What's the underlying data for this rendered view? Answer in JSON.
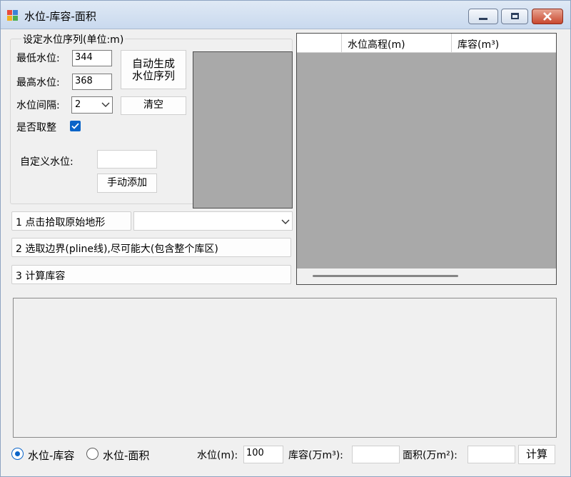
{
  "window": {
    "title": "水位-库容-面积"
  },
  "settings": {
    "group_title": "设定水位序列(单位:m)",
    "min_label": "最低水位:",
    "min_value": "344",
    "max_label": "最高水位:",
    "max_value": "368",
    "interval_label": "水位间隔:",
    "interval_value": "2",
    "round_label": "是否取整",
    "round_checked": true,
    "auto_generate_label": "自动生成\n水位序列",
    "clear_label": "清空",
    "custom_label": "自定义水位:",
    "custom_value": "",
    "manual_add_label": "手动添加"
  },
  "steps": {
    "step1_label": "1 点击拾取原始地形",
    "terrain_value": "",
    "step2_label": "2 选取边界(pline线),尽可能大(包含整个库区)",
    "step3_label": "3 计算库容"
  },
  "grid": {
    "columns": [
      "",
      "水位高程(m)",
      "库容(m³)"
    ]
  },
  "bottom": {
    "radio1_label": "水位-库容",
    "radio1_checked": true,
    "radio2_label": "水位-面积",
    "radio2_checked": false,
    "level_label": "水位(m):",
    "level_value": "100",
    "capacity_label": "库容(万m³):",
    "capacity_value": "",
    "area_label": "面积(万m²):",
    "area_value": "",
    "calc_label": "计算"
  },
  "icons": {
    "app": "app-icon",
    "minimize": "minimize-icon",
    "maximize": "maximize-icon",
    "close": "close-icon",
    "check": "check-icon",
    "dropdown": "chevron-down-icon"
  }
}
